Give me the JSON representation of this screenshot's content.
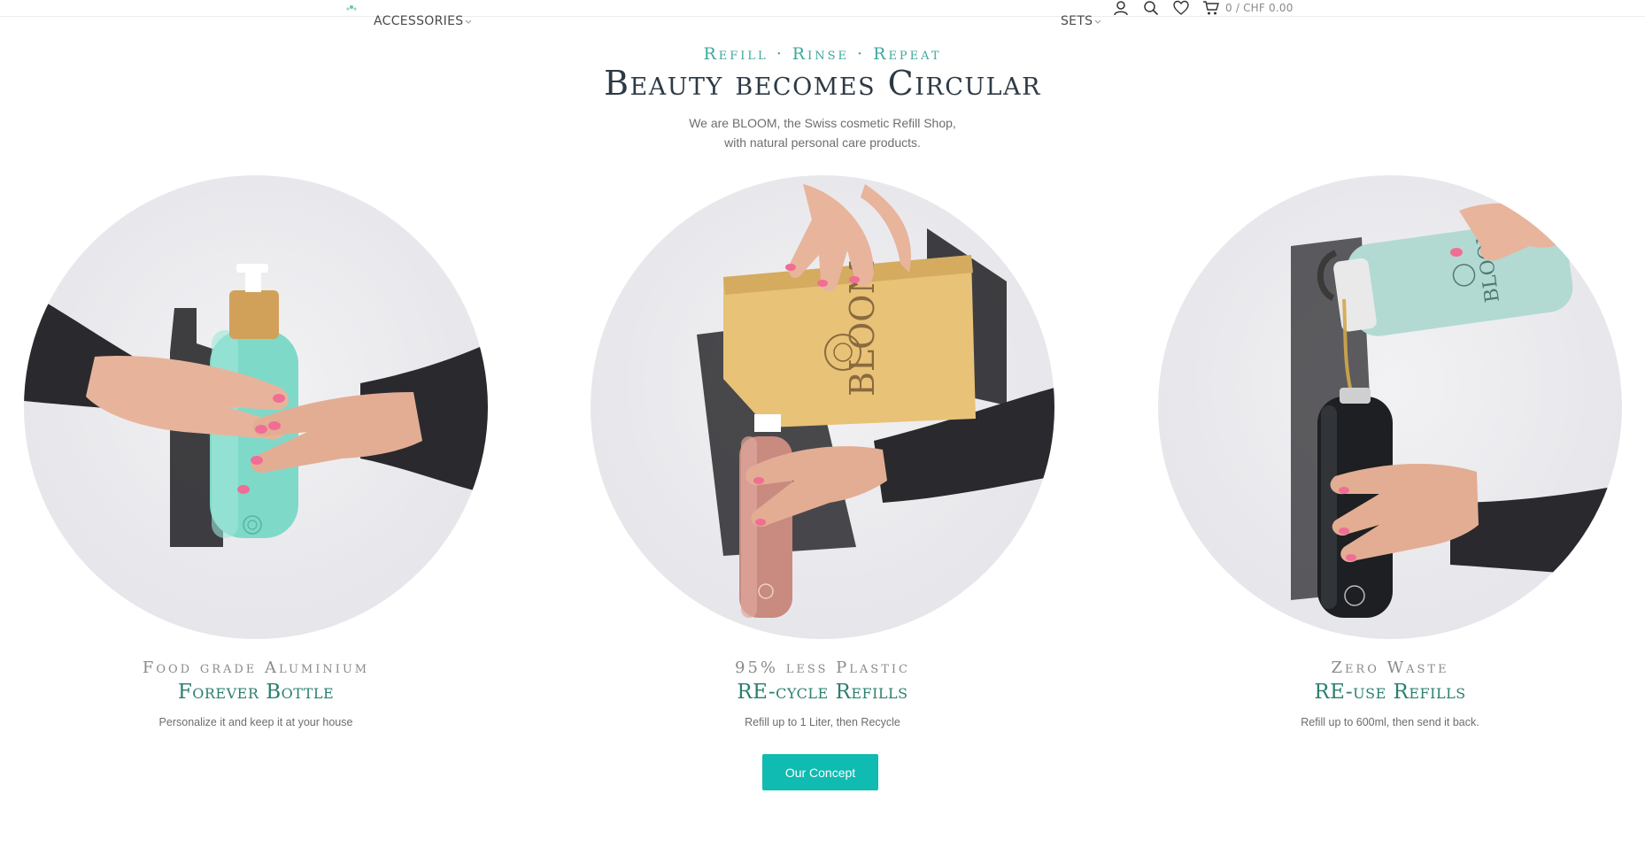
{
  "header": {
    "logo_icon": "bloom-flower-icon",
    "nav": {
      "accessories": "ACCESSORIES",
      "sets": "SETS"
    },
    "icons": [
      "user-icon",
      "search-icon",
      "heart-icon",
      "cart-icon"
    ],
    "cart_total": "0 / CHF 0.00"
  },
  "hero": {
    "eyebrow": "Refill · Rinse · Repeat",
    "title": "Beauty becomes Circular",
    "subtitle_line1": "We are BLOOM, the Swiss cosmetic Refill Shop,",
    "subtitle_line2": "with natural personal care products."
  },
  "features": [
    {
      "kicker": "Food grade Aluminium",
      "title": "Forever Bottle",
      "desc": "Personalize it and keep it at your house"
    },
    {
      "kicker": "95% less Plastic",
      "title": "RE-cycle Refills",
      "desc": "Refill up to 1 Liter, then Recycle"
    },
    {
      "kicker": "Zero Waste",
      "title": "RE-use Refills",
      "desc": "Refill up to 600ml, then send it back."
    }
  ],
  "cta": {
    "label": "Our Concept"
  },
  "colors": {
    "accent": "#10bbb1",
    "eyebrow": "#3ea79b",
    "feature_title": "#2b7f6f",
    "hero_title": "#2d3a45"
  }
}
